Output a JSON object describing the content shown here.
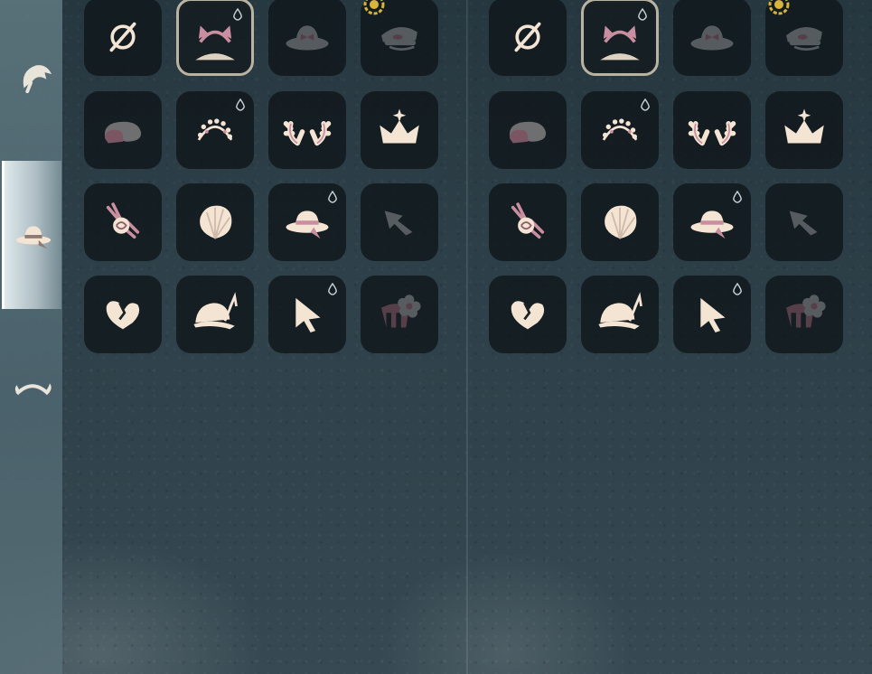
{
  "sidebar": {
    "tabs": [
      {
        "name": "sidebar-tab-hair",
        "icon": "hair-icon",
        "active": false
      },
      {
        "name": "sidebar-tab-hat",
        "icon": "hat-icon",
        "active": true
      },
      {
        "name": "sidebar-tab-horns",
        "icon": "horns-icon",
        "active": false
      }
    ]
  },
  "panels": [
    {
      "name": "accessory-grid-left",
      "items": [
        {
          "icon": "none-icon",
          "selected": false,
          "drop": false,
          "badge": false
        },
        {
          "icon": "cat-ear-headband-icon",
          "selected": true,
          "drop": true,
          "badge": false
        },
        {
          "icon": "bow-sunhat-icon",
          "selected": false,
          "drop": false,
          "badge": false,
          "dim": true
        },
        {
          "icon": "captain-cap-icon",
          "selected": false,
          "drop": false,
          "badge": true,
          "dim": true
        },
        {
          "icon": "rock-hat-icon",
          "selected": false,
          "drop": false,
          "badge": false
        },
        {
          "icon": "flower-crown-icon",
          "selected": false,
          "drop": true,
          "badge": false
        },
        {
          "icon": "antlers-icon",
          "selected": false,
          "drop": false,
          "badge": false
        },
        {
          "icon": "crown-icon",
          "selected": false,
          "drop": false,
          "badge": false
        },
        {
          "icon": "rose-hairpin-icon",
          "selected": false,
          "drop": false,
          "badge": false
        },
        {
          "icon": "seashell-icon",
          "selected": false,
          "drop": false,
          "badge": false
        },
        {
          "icon": "sunhat-icon",
          "selected": false,
          "drop": true,
          "badge": false
        },
        {
          "icon": "fish-clip-icon",
          "selected": false,
          "drop": false,
          "badge": false,
          "dim": true
        },
        {
          "icon": "heart-clip-icon",
          "selected": false,
          "drop": false,
          "badge": false
        },
        {
          "icon": "feather-hat-icon",
          "selected": false,
          "drop": false,
          "badge": false
        },
        {
          "icon": "pointer-icon",
          "selected": false,
          "drop": true,
          "badge": false
        },
        {
          "icon": "flower-comb-icon",
          "selected": false,
          "drop": false,
          "badge": false,
          "dim": true
        }
      ]
    },
    {
      "name": "accessory-grid-right",
      "items": [
        {
          "icon": "none-icon",
          "selected": false,
          "drop": false,
          "badge": false
        },
        {
          "icon": "cat-ear-headband-icon",
          "selected": true,
          "drop": true,
          "badge": false
        },
        {
          "icon": "bow-sunhat-icon",
          "selected": false,
          "drop": false,
          "badge": false,
          "dim": true
        },
        {
          "icon": "captain-cap-icon",
          "selected": false,
          "drop": false,
          "badge": true,
          "dim": true
        },
        {
          "icon": "rock-hat-icon",
          "selected": false,
          "drop": false,
          "badge": false
        },
        {
          "icon": "flower-crown-icon",
          "selected": false,
          "drop": true,
          "badge": false
        },
        {
          "icon": "antlers-icon",
          "selected": false,
          "drop": false,
          "badge": false
        },
        {
          "icon": "crown-icon",
          "selected": false,
          "drop": false,
          "badge": false
        },
        {
          "icon": "rose-hairpin-icon",
          "selected": false,
          "drop": false,
          "badge": false
        },
        {
          "icon": "seashell-icon",
          "selected": false,
          "drop": false,
          "badge": false
        },
        {
          "icon": "sunhat-icon",
          "selected": false,
          "drop": true,
          "badge": false
        },
        {
          "icon": "fish-clip-icon",
          "selected": false,
          "drop": false,
          "badge": false,
          "dim": true
        },
        {
          "icon": "heart-clip-icon",
          "selected": false,
          "drop": false,
          "badge": false
        },
        {
          "icon": "feather-hat-icon",
          "selected": false,
          "drop": false,
          "badge": false
        },
        {
          "icon": "pointer-icon",
          "selected": false,
          "drop": true,
          "badge": false
        },
        {
          "icon": "flower-comb-icon",
          "selected": false,
          "drop": false,
          "badge": false,
          "dim": true
        }
      ]
    }
  ],
  "colors": {
    "cream": "#f3e4d3",
    "rose": "#c98fa0",
    "rose_dark": "#8d5a6a",
    "slot_bg": "#0e1418",
    "selected_border": "#b9b3a2",
    "badge_gold": "#d8b43a",
    "grey": "#8d8f92"
  }
}
